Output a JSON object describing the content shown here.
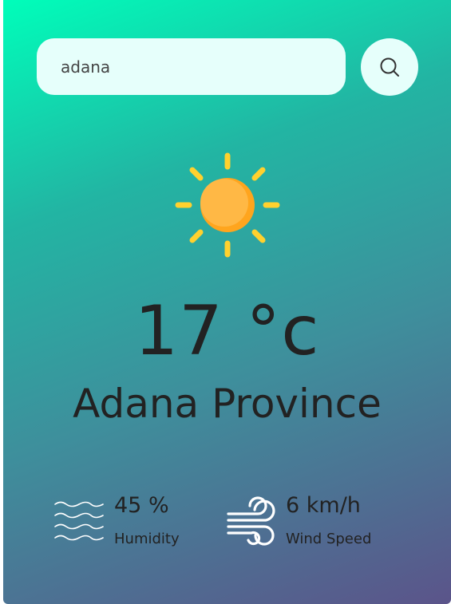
{
  "search": {
    "value": "adana",
    "search_icon": "search-icon"
  },
  "weather": {
    "icon": "sun-icon",
    "temperature": "17 °c",
    "city": "Adana Province"
  },
  "details": {
    "humidity": {
      "icon": "humidity-waves-icon",
      "value": "45 %",
      "label": "Humidity"
    },
    "wind": {
      "icon": "wind-icon",
      "value": "6 km/h",
      "label": "Wind Speed"
    }
  },
  "colors": {
    "gradient_top": "#00feba",
    "gradient_bottom": "#5b548a",
    "input_background": "#e6fffb",
    "sun_body": "#ffb13b",
    "sun_rays": "#ffd12e"
  }
}
